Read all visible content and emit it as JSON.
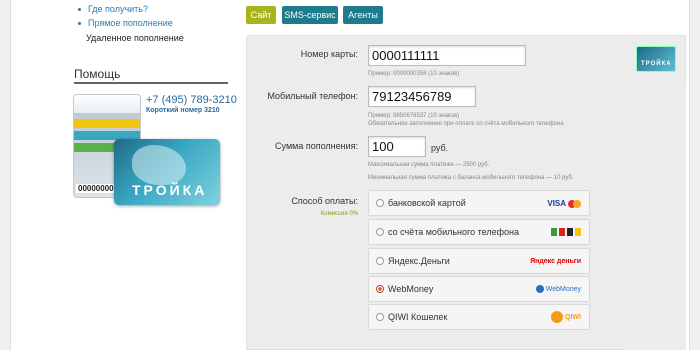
{
  "sidebar": {
    "items": [
      {
        "label": "Где получить?"
      },
      {
        "label": "Прямое пополнение"
      },
      {
        "label": "Удаленное пополнение"
      }
    ],
    "help_title": "Помощь",
    "phone": "+7 (495) 789-3210",
    "short_number": "Короткий номер 3210",
    "card_number": "00000000",
    "card_brand": "ТРОЙКА"
  },
  "tabs": [
    {
      "label": "Сайт"
    },
    {
      "label": "SMS-сервис"
    },
    {
      "label": "Агенты"
    }
  ],
  "form": {
    "card_label": "Номер карты:",
    "card_value": "0000111111",
    "card_hint": "Пример: 0000000358 (10 знаков)",
    "phone_label": "Мобильный телефон:",
    "phone_value": "79123456789",
    "phone_hint1": "Пример: 9650676537 (10 знаков)",
    "phone_hint2": "Обязательное заполнение при оплате со счёта мобильного телефона",
    "amount_label": "Сумма пополнения:",
    "amount_value": "100",
    "amount_unit": "руб.",
    "amount_hint1": "Максимальная сумма платежа — 2500 руб.",
    "amount_hint2": "Минимальная сумма платежа с баланса мобильного телефона — 10 руб.",
    "method_label": "Способ оплаты:",
    "commission": "Комиссия 0%"
  },
  "logo": {
    "label": "ТРОЙКА"
  },
  "payment_options": [
    {
      "label": "банковской картой",
      "icon": "visa-mastercard-icon",
      "icon_text": "VISA",
      "selected": false
    },
    {
      "label": "со счёта мобильного телефона",
      "icon": "mobile-operators-icon",
      "icon_text": "",
      "selected": false
    },
    {
      "label": "Яндекс.Деньги",
      "icon": "yandex-money-icon",
      "icon_text": "Яндекс деньги",
      "selected": false
    },
    {
      "label": "WebMoney",
      "icon": "webmoney-icon",
      "icon_text": "WebMoney",
      "selected": true
    },
    {
      "label": "QIWI Кошелек",
      "icon": "qiwi-icon",
      "icon_text": "QIWI",
      "selected": false
    }
  ],
  "colors": {
    "accent_green": "#a7b41c",
    "accent_teal": "#1d7b8c",
    "link_blue": "#2a7ab0"
  }
}
